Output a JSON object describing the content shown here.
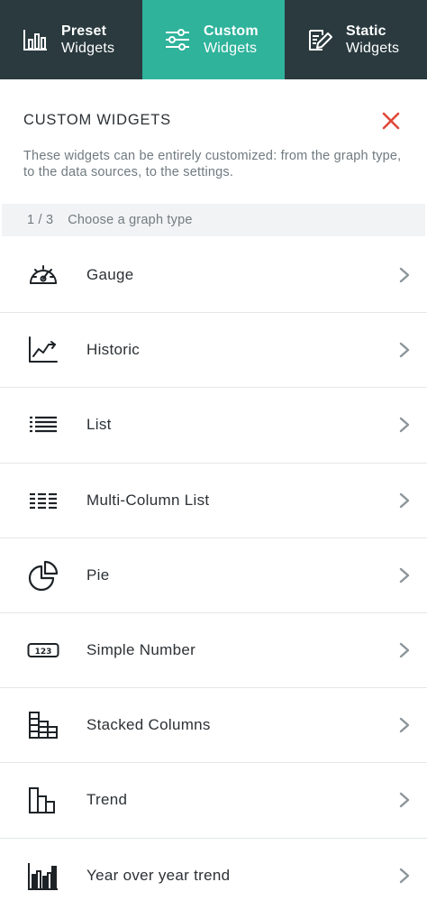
{
  "tabs": [
    {
      "line1": "Preset",
      "line2": "Widgets",
      "icon": "bar-chart-icon",
      "active": false
    },
    {
      "line1": "Custom",
      "line2": "Widgets",
      "icon": "sliders-icon",
      "active": true
    },
    {
      "line1": "Static",
      "line2": "Widgets",
      "icon": "edit-note-icon",
      "active": false
    }
  ],
  "header": {
    "title": "CUSTOM WIDGETS",
    "description": "These widgets can be entirely customized: from the graph type, to the data sources, to the settings."
  },
  "step": {
    "count": "1 / 3",
    "label": "Choose a graph type"
  },
  "graph_types": [
    {
      "label": "Gauge",
      "icon": "gauge-icon"
    },
    {
      "label": "Historic",
      "icon": "line-chart-icon"
    },
    {
      "label": "List",
      "icon": "list-icon"
    },
    {
      "label": "Multi-Column List",
      "icon": "multi-column-list-icon"
    },
    {
      "label": "Pie",
      "icon": "pie-chart-icon"
    },
    {
      "label": "Simple Number",
      "icon": "number-icon"
    },
    {
      "label": "Stacked Columns",
      "icon": "stacked-columns-icon"
    },
    {
      "label": "Trend",
      "icon": "trend-icon"
    },
    {
      "label": "Year over year trend",
      "icon": "year-over-year-icon"
    }
  ],
  "colors": {
    "tab_bar": "#2a3a3f",
    "tab_active": "#2fb39b",
    "close": "#e0493a",
    "chevron": "#8b959a"
  }
}
